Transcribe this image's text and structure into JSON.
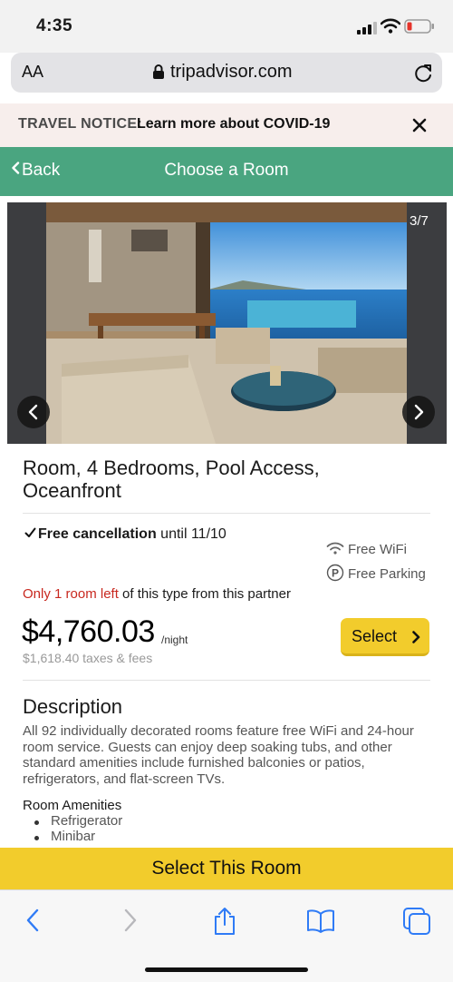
{
  "status": {
    "time": "4:35"
  },
  "browser": {
    "text_size": "AA",
    "domain": "tripadvisor.com"
  },
  "notice": {
    "label": "TRAVEL NOTICE:",
    "link": "Learn more about COVID-19"
  },
  "nav": {
    "back": "Back",
    "title": "Choose a Room"
  },
  "gallery": {
    "counter": "3/7"
  },
  "room": {
    "title": "Room, 4 Bedrooms, Pool Access, Oceanfront",
    "cancellation_bold": "Free cancellation",
    "cancellation_rest": " until 11/10",
    "amenity_wifi": "Free WiFi",
    "amenity_parking": "Free Parking",
    "rooms_left_red": "Only 1 room left",
    "rooms_left_rest": " of this type from this partner",
    "price": "$4,760.03",
    "per_night": "/night",
    "taxes": "$1,618.40 taxes & fees",
    "select": "Select"
  },
  "description": {
    "heading": "Description",
    "body": "All 92 individually decorated rooms feature free WiFi and 24-hour room service. Guests can enjoy deep soaking tubs, and other standard amenities include furnished balconies or patios, refrigerators, and flat-screen TVs.",
    "amenities_heading": "Room Amenities",
    "amenities": [
      "Refrigerator",
      "Minibar"
    ]
  },
  "cta": {
    "label": "Select This Room"
  },
  "colors": {
    "brand_green": "#4aa580",
    "cta_yellow": "#f2cc2c",
    "alert_red": "#c8281f"
  },
  "toolbar_icons": [
    "back-icon",
    "forward-icon",
    "share-icon",
    "bookmarks-icon",
    "tabs-icon"
  ]
}
